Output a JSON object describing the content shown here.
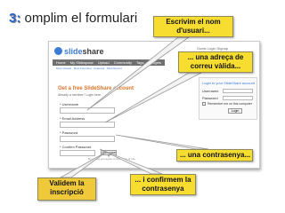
{
  "slide": {
    "number": "3:",
    "title": " omplim el formulari"
  },
  "screenshot": {
    "logo_part1": "slide",
    "logo_part2": "share",
    "nav_items": [
      "Home",
      "My Slidespace",
      "Upload",
      "Community",
      "Tags",
      "Widgets"
    ],
    "subnav": "Most Viewed · Most Favorited · Featured · Most Recent",
    "topright": "Guest  Login  Signup",
    "form_title": "Get a free SlideShare account",
    "form_subtitle": "Already a member? Login here",
    "fields": {
      "username": "* Username",
      "email": "* Email Address",
      "password": "* Password",
      "confirm": "* Confirm Password"
    },
    "join_button": "Join now »",
    "terms": "By joining you agree to the terms of use",
    "login": {
      "heading": "Login to your SlideShare account",
      "username": "Username",
      "password": "Password",
      "remember": "Remember me on this computer",
      "button": "Login"
    }
  },
  "callouts": {
    "username": [
      "Escrivim el nom",
      "d'usuari..."
    ],
    "email": [
      "... una adreça de",
      "correu vàlida..."
    ],
    "password": "... una contrasenya...",
    "confirm": [
      "... i confirmem la",
      "contrasenya"
    ],
    "submit": [
      "Validem la",
      "inscripció"
    ]
  },
  "colors": {
    "callout": "#f6dd2f",
    "callout_dark": "#f0c93a",
    "title_number": "#2a62c9",
    "form_title": "#e07428",
    "link_blue": "#3b7bd6"
  }
}
